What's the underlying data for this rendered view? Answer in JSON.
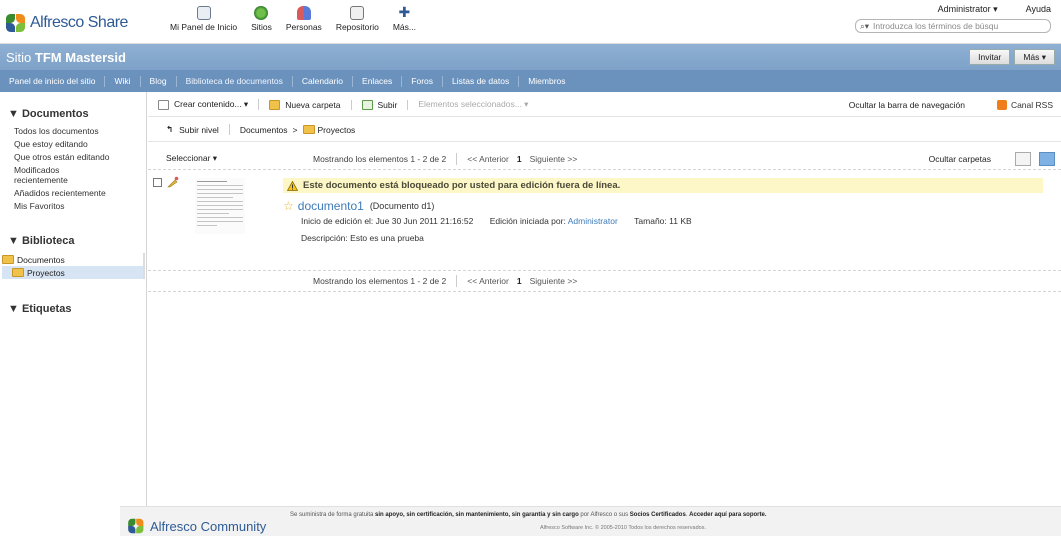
{
  "header": {
    "logo": "Alfresco Share",
    "nav": [
      {
        "label": "Mi Panel de Inicio",
        "icon": "dashboard-icon"
      },
      {
        "label": "Sitios",
        "icon": "sites-icon"
      },
      {
        "label": "Personas",
        "icon": "people-icon"
      },
      {
        "label": "Repositorio",
        "icon": "repository-icon"
      },
      {
        "label": "Más...",
        "icon": "more-icon"
      }
    ],
    "user": "Administrator ▾",
    "help": "Ayuda",
    "search_placeholder": "Introduzca los términos de búsqu"
  },
  "site": {
    "title_prefix": "Sitio",
    "title": "TFM Mastersid",
    "invite": "Invitar",
    "more": "Más ▾"
  },
  "site_nav": [
    "Panel de inicio del sitio",
    "Wiki",
    "Blog",
    "Biblioteca de documentos",
    "Calendario",
    "Enlaces",
    "Foros",
    "Listas de datos",
    "Miembros"
  ],
  "sidebar": {
    "documents_heading": "▼ Documentos",
    "filters": [
      "Todos los documentos",
      "Que estoy editando",
      "Que otros están editando",
      "Modificados recientemente",
      "Añadidos recientemente",
      "Mis Favoritos"
    ],
    "library_heading": "▼ Biblioteca",
    "tree_root": "Documentos",
    "tree_child": "Proyectos",
    "tags_heading": "▼ Etiquetas"
  },
  "toolbar": {
    "create": "Crear contenido... ▾",
    "new_folder": "Nueva carpeta",
    "upload": "Subir",
    "selected": "Elementos seleccionados... ▾",
    "hide_nav": "Ocultar la barra de navegación",
    "rss": "Canal RSS"
  },
  "breadcrumb": {
    "up": "Subir nivel",
    "root": "Documentos",
    "sep": ">",
    "current": "Proyectos"
  },
  "list": {
    "select": "Seleccionar ▾",
    "showing": "Mostrando los elementos 1 - 2 de 2",
    "prev": "<< Anterior",
    "page": "1",
    "next": "Siguiente >>",
    "hide_folders": "Ocultar carpetas"
  },
  "document": {
    "lock_message": "Este documento está bloqueado por usted para edición fuera de línea.",
    "name": "documento1",
    "title": "(Documento d1)",
    "edit_start_label": "Inicio de edición el:",
    "edit_start_value": "Jue 30 Jun 2011 21:16:52",
    "edited_by_label": "Edición iniciada por:",
    "edited_by_value": "Administrator",
    "size_label": "Tamaño:",
    "size_value": "11 KB",
    "description_label": "Descripción:",
    "description_value": "Esto es una prueba"
  },
  "footer": {
    "logo": "Alfresco Community",
    "text_a": "Se suministra de forma gratuita ",
    "text_b": "sin apoyo, sin certificación, sin mantenimiento, sin garantía y sin cargo",
    "text_c": " por Alfresco o sus ",
    "text_d": "Socios Certificados",
    "text_e": ". ",
    "text_f": "Acceder aquí para soporte.",
    "copyright": "Alfresco Software Inc. © 2005-2010 Todos los derechos reservados."
  },
  "colors": {
    "site_bar": "#7da1c8",
    "site_nav": "#6b92bd",
    "link": "#3e7bb8",
    "warning_bg": "#fdf6c6"
  }
}
